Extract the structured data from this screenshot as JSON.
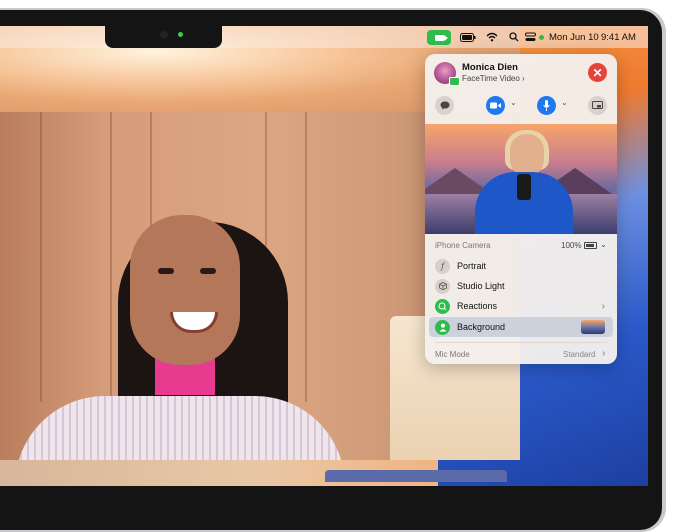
{
  "menubar": {
    "date": "Mon Jun 10",
    "time": "9:41 AM",
    "icons": [
      "facetime-icon",
      "battery-icon",
      "wifi-icon",
      "search-icon",
      "control-center-icon",
      "siri-icon"
    ]
  },
  "call": {
    "caller_name": "Monica Dien",
    "call_type": "FaceTime Video",
    "call_type_chevron": "›"
  },
  "controls": {
    "chat_icon": "message-icon",
    "video_icon": "video-camera-icon",
    "mic_icon": "microphone-icon",
    "screen_icon": "screen-share-icon",
    "close_symbol": "✕"
  },
  "camera": {
    "source_label": "iPhone Camera",
    "battery_percent": "100%",
    "chevron": "⌄"
  },
  "effects": [
    {
      "label": "Portrait",
      "icon": "f-aperture-icon",
      "selected": false
    },
    {
      "label": "Studio Light",
      "icon": "cube-icon",
      "selected": false
    },
    {
      "label": "Reactions",
      "icon": "reactions-icon",
      "selected": false,
      "has_arrow": true
    },
    {
      "label": "Background",
      "icon": "person-icon",
      "selected": true
    }
  ],
  "mic_mode": {
    "label": "Mic Mode",
    "value": "Standard",
    "arrow": "›"
  },
  "colors": {
    "accent_blue": "#1d79f2",
    "facetime_green": "#2ebd4c",
    "close_red": "#e8433b"
  }
}
